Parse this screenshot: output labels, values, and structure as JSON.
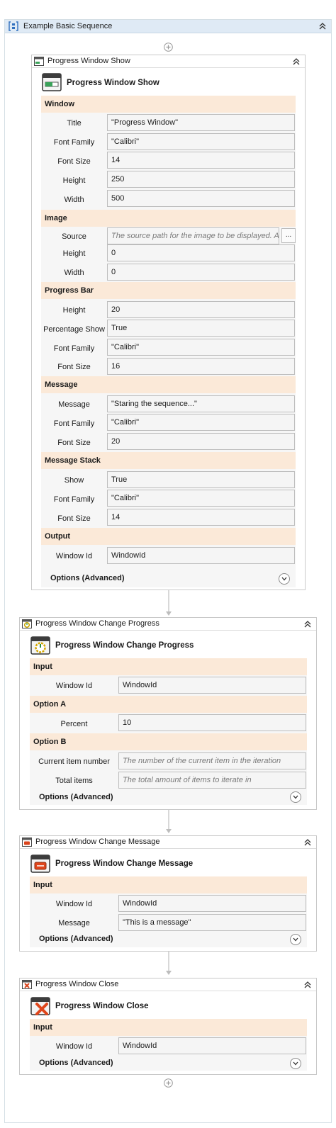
{
  "sequence": {
    "title": "Example Basic Sequence"
  },
  "colors": {
    "section_bg": "#fbe9d8",
    "header_bg": "#dfeaf5",
    "field_bg": "#f5f5f5",
    "border": "#c9c9c9"
  },
  "show": {
    "header_title": "Progress Window Show",
    "title": "Progress Window Show",
    "window": {
      "section": "Window",
      "title_label": "Title",
      "title_value": "\"Progress Window\"",
      "font_family_label": "Font Family",
      "font_family_value": "\"Calibri\"",
      "font_size_label": "Font Size",
      "font_size_value": "14",
      "height_label": "Height",
      "height_value": "250",
      "width_label": "Width",
      "width_value": "500"
    },
    "image": {
      "section": "Image",
      "source_label": "Source",
      "source_placeholder": "The source path for the image to be displayed. Acc",
      "browse_label": "...",
      "height_label": "Height",
      "height_value": "0",
      "width_label": "Width",
      "width_value": "0"
    },
    "progress_bar": {
      "section": "Progress Bar",
      "height_label": "Height",
      "height_value": "20",
      "percentage_show_label": "Percentage Show",
      "percentage_show_value": "True",
      "font_family_label": "Font Family",
      "font_family_value": "\"Calibri\"",
      "font_size_label": "Font Size",
      "font_size_value": "16"
    },
    "message": {
      "section": "Message",
      "message_label": "Message",
      "message_value": "\"Staring the sequence...\"",
      "font_family_label": "Font Family",
      "font_family_value": "\"Calibri\"",
      "font_size_label": "Font Size",
      "font_size_value": "20"
    },
    "message_stack": {
      "section": "Message Stack",
      "show_label": "Show",
      "show_value": "True",
      "font_family_label": "Font Family",
      "font_family_value": "\"Calibri\"",
      "font_size_label": "Font Size",
      "font_size_value": "14"
    },
    "output": {
      "section": "Output",
      "window_id_label": "Window Id",
      "window_id_value": "WindowId"
    },
    "options": "Options (Advanced)"
  },
  "change_progress": {
    "header_title": "Progress Window Change Progress",
    "title": "Progress Window Change Progress",
    "input_section": "Input",
    "window_id_label": "Window Id",
    "window_id_value": "WindowId",
    "option_a_section": "Option A",
    "percent_label": "Percent",
    "percent_value": "10",
    "option_b_section": "Option B",
    "current_item_label": "Current item number",
    "current_item_placeholder": "The number of the current item in the iteration",
    "total_items_label": "Total items",
    "total_items_placeholder": "The total amount of items to iterate in",
    "options": "Options (Advanced)"
  },
  "change_message": {
    "header_title": "Progress Window Change Message",
    "title": "Progress Window Change Message",
    "input_section": "Input",
    "window_id_label": "Window Id",
    "window_id_value": "WindowId",
    "message_label": "Message",
    "message_value": "\"This is a message\"",
    "options": "Options (Advanced)"
  },
  "close": {
    "header_title": "Progress Window Close",
    "title": "Progress Window Close",
    "input_section": "Input",
    "window_id_label": "Window Id",
    "window_id_value": "WindowId",
    "options": "Options (Advanced)"
  }
}
